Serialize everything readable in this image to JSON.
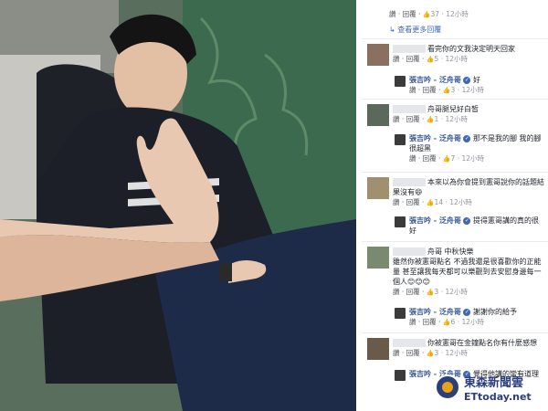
{
  "photo": {
    "alt_subject": "photo-man-kissing-foot"
  },
  "comments": {
    "top_meta": {
      "reply": "讚 · 回覆 · ",
      "likes": "37",
      "time": " · 12小時"
    },
    "more_replies": "查看更多回覆",
    "c1": {
      "text": "看完你的文我決定明天回家",
      "reply": "讚 · 回覆 · ",
      "likes": "5",
      "time": " · 12小時"
    },
    "r1": {
      "name": "張吉吟 - 泛舟哥",
      "text": "好",
      "reply": "讚 · 回覆 · ",
      "likes": "3",
      "time": " · 12小時"
    },
    "c2": {
      "text": "舟哥腿兒好白皙",
      "reply": "讚 · 回覆 · ",
      "likes": "1",
      "time": " · 12小時"
    },
    "r2": {
      "name": "張吉吟 - 泛舟哥",
      "text": "那不是我的腳 我的腳很超黑",
      "reply": "讚 · 回覆 · ",
      "likes": "7",
      "time": " · 12小時"
    },
    "c3": {
      "text": "本來以為你會提到憲哥說你的話題結果沒有",
      "emoji": "😄",
      "reply": "讚 · 回覆 · ",
      "likes": "14",
      "time": " · 12小時"
    },
    "r3": {
      "name": "張吉吟 - 泛舟哥",
      "text": "提得憲哥講的真的很好",
      "reply": "讚 · 回覆 · ",
      "likes": "",
      "time": ""
    },
    "c4": {
      "prefix": "舟哥 中秋快樂",
      "text": "雖然你被憲哥點名 不過我還是很喜歡你的正能量 甚至讓我每天都可以樂觀到去安慰身邊每一個人",
      "emoji": "😊😊😊",
      "reply": "讚 · 回覆 · ",
      "likes": "3",
      "time": " · 12小時"
    },
    "r4": {
      "name": "張吉吟 - 泛舟哥",
      "text": "謝謝你的給予",
      "reply": "讚 · 回覆 · ",
      "likes": "6",
      "time": " · 12小時"
    },
    "c5": {
      "text": "你被憲哥在金鐘點名你有什麼感想",
      "reply": "讚 · 回覆 · ",
      "likes": "3",
      "time": " · 12小時"
    },
    "r5": {
      "name": "張吉吟 - 泛舟哥",
      "text": "覺得他講的蠻有道理",
      "reply": "",
      "likes": "",
      "time": ""
    }
  },
  "watermark": {
    "line1": "東森新聞雲",
    "line2": "ETtoday.net"
  }
}
